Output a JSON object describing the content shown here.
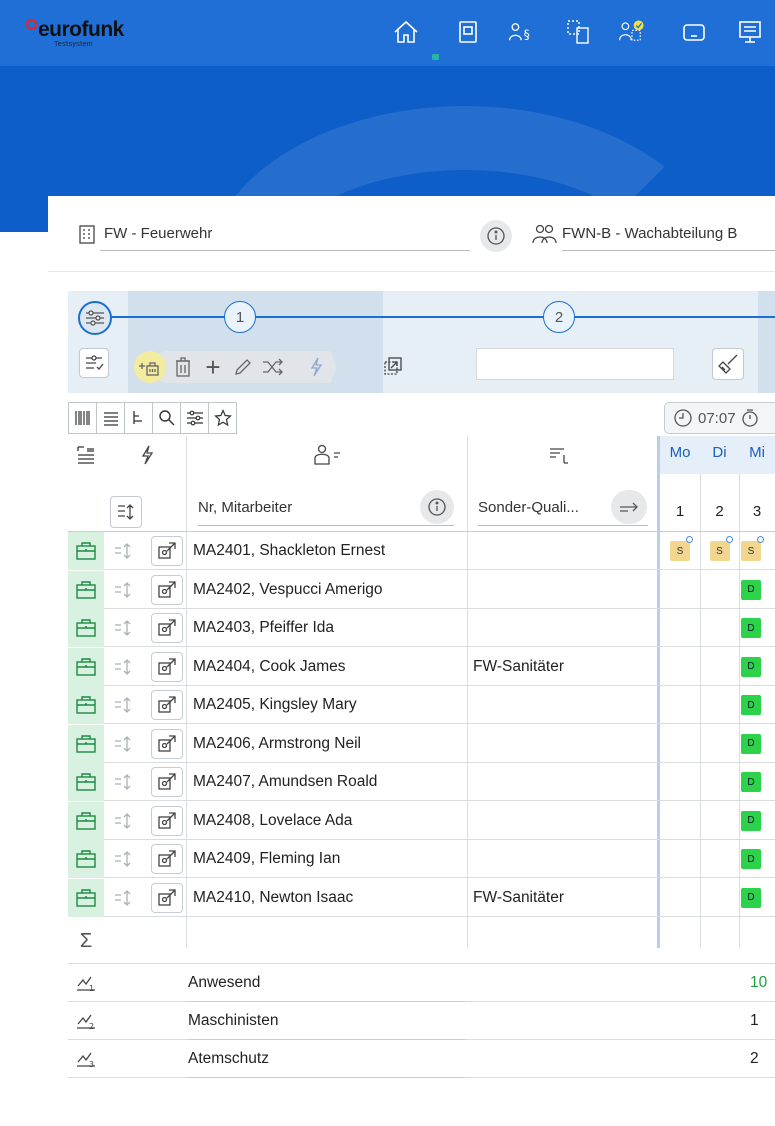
{
  "app": {
    "logo_text": "eurofunk",
    "logo_subtitle": "Testsystem"
  },
  "colors": {
    "header_blue": "#1f6fd6",
    "hero_blue": "#0d5ec9",
    "accent": "#1b6fd1",
    "shift_s": "#f2d58f",
    "shift_d": "#2bd24a",
    "present_green": "#1aa33a",
    "bag_bg": "#d9f1e1"
  },
  "nav_icons": [
    "home-icon",
    "phone-icon",
    "persons-paragraph-icon",
    "devices-icon",
    "person-check-icon",
    "tablet-icon",
    "monitor-icon"
  ],
  "context": {
    "org_label": "FW - Feuerwehr",
    "unit_label": "FWN-B - Wachabteilung B"
  },
  "wizard": {
    "step1": "1",
    "step2": "2"
  },
  "time": {
    "value": "07:07"
  },
  "table": {
    "name_header": "Nr, Mitarbeiter",
    "qual_header": "Sonder-Quali...",
    "days": [
      {
        "dow": "Mo",
        "num": "1"
      },
      {
        "dow": "Di",
        "num": "2"
      },
      {
        "dow": "Mi",
        "num": "3"
      }
    ],
    "rows": [
      {
        "name": "MA2401, Shackleton Ernest",
        "qual": "",
        "shifts": [
          "S",
          "S",
          "S"
        ]
      },
      {
        "name": "MA2402, Vespucci Amerigo",
        "qual": "",
        "shifts": [
          "",
          "",
          "D"
        ]
      },
      {
        "name": "MA2403, Pfeiffer Ida",
        "qual": "",
        "shifts": [
          "",
          "",
          "D"
        ]
      },
      {
        "name": "MA2404, Cook James",
        "qual": "FW-Sanitäter",
        "shifts": [
          "",
          "",
          "D"
        ]
      },
      {
        "name": "MA2405, Kingsley Mary",
        "qual": "",
        "shifts": [
          "",
          "",
          "D"
        ]
      },
      {
        "name": "MA2406, Armstrong Neil",
        "qual": "",
        "shifts": [
          "",
          "",
          "D"
        ]
      },
      {
        "name": "MA2407, Amundsen Roald",
        "qual": "",
        "shifts": [
          "",
          "",
          "D"
        ]
      },
      {
        "name": "MA2408, Lovelace Ada",
        "qual": "",
        "shifts": [
          "",
          "",
          "D"
        ]
      },
      {
        "name": "MA2409, Fleming Ian",
        "qual": "",
        "shifts": [
          "",
          "",
          "D"
        ]
      },
      {
        "name": "MA2410, Newton Isaac",
        "qual": "FW-Sanitäter",
        "shifts": [
          "",
          "",
          "D"
        ]
      }
    ],
    "sum_symbol": "Σ",
    "stats": [
      {
        "label": "Anwesend",
        "value": "10"
      },
      {
        "label": "Maschinisten",
        "value": "1"
      },
      {
        "label": "Atemschutz",
        "value": "2"
      }
    ]
  }
}
